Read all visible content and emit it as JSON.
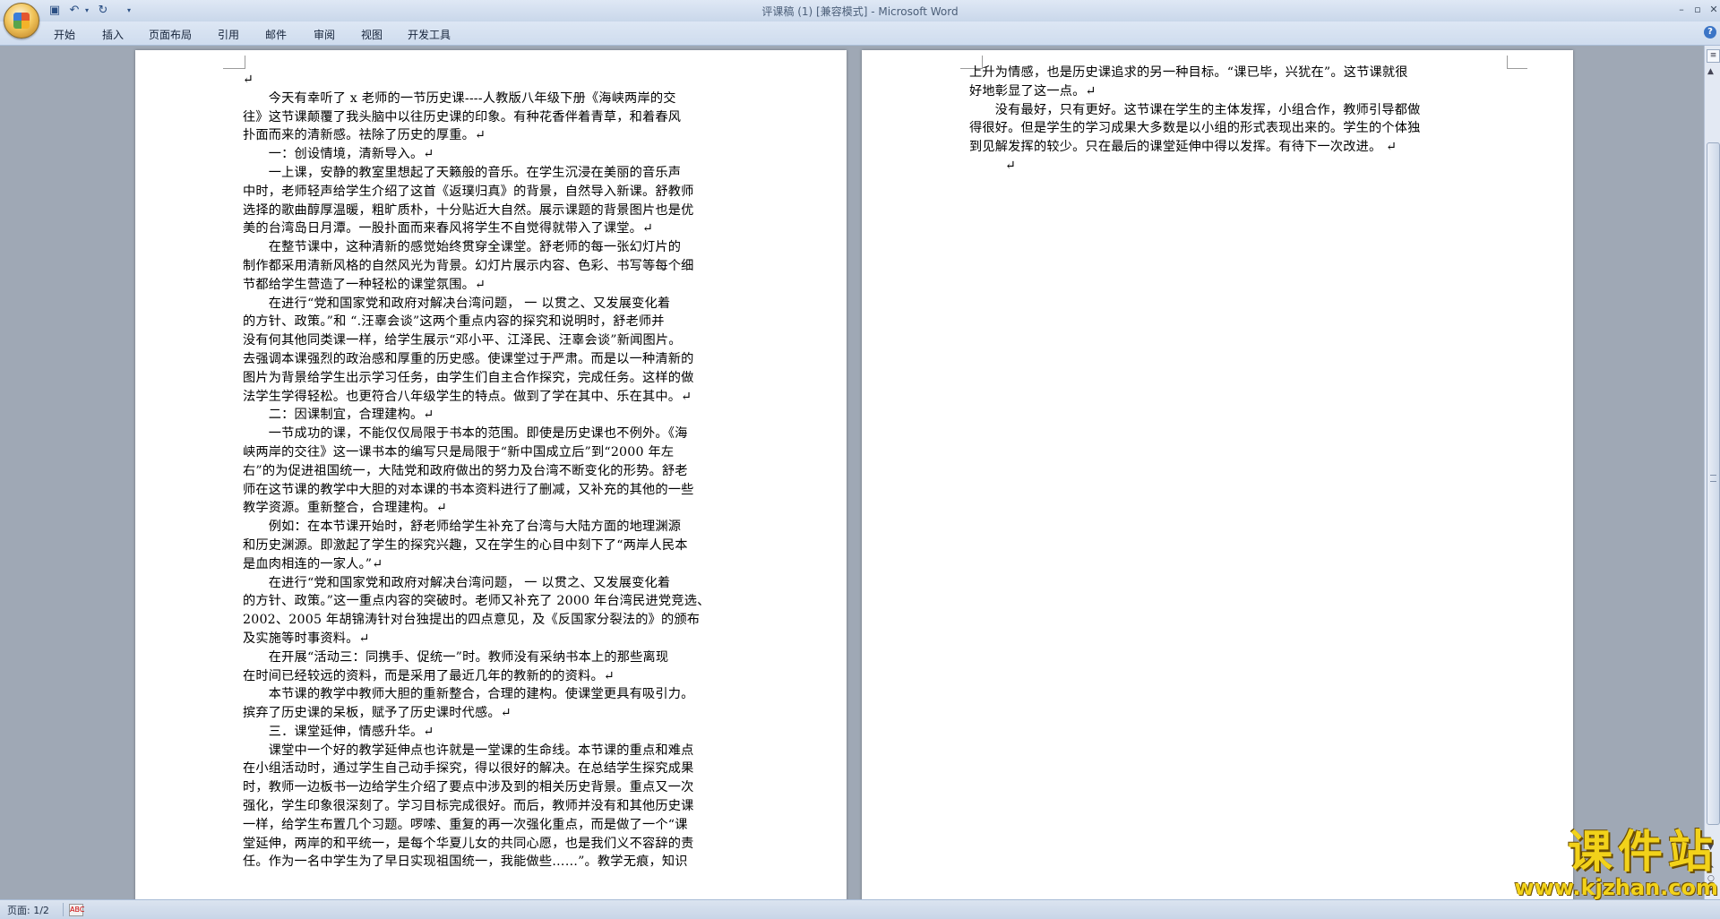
{
  "quick_access": {
    "save_icon": "▣",
    "undo_icon": "↶",
    "undo_dropdown_icon": "▾",
    "redo_icon": "↻",
    "customize_icon": "▾"
  },
  "window": {
    "title": "评课稿 (1) [兼容模式] - Microsoft Word",
    "min": "–",
    "max": "▫",
    "close": "✕"
  },
  "ribbon": {
    "tabs": [
      "开始",
      "插入",
      "页面布局",
      "引用",
      "邮件",
      "审阅",
      "视图",
      "开发工具"
    ],
    "help_icon": "?"
  },
  "document": {
    "page1_lines": [
      "↵",
      "　　今天有幸听了 x 老师的一节历史课----人教版八年级下册《海峡两岸的交",
      "往》这节课颠覆了我头脑中以往历史课的印象。有种花香伴着青草，和着春风",
      "扑面而来的清新感。祛除了历史的厚重。↵",
      "　　一：创设情境，清新导入。↵",
      "　　一上课，安静的教室里想起了天籁般的音乐。在学生沉浸在美丽的音乐声",
      "中时，老师轻声给学生介绍了这首《返璞归真》的背景，自然导入新课。舒教师",
      "选择的歌曲醇厚温暖，粗旷质朴，十分贴近大自然。展示课题的背景图片也是优",
      "美的台湾岛日月潭。一股扑面而来春风将学生不自觉得就带入了课堂。↵",
      "　　在整节课中，这种清新的感觉始终贯穿全课堂。舒老师的每一张幻灯片的",
      "制作都采用清新风格的自然风光为背景。幻灯片展示内容、色彩、书写等每个细",
      "节都给学生营造了一种轻松的课堂氛围。↵",
      "　　在进行“党和国家党和政府对解决台湾问题， 一 以贯之、又发展变化着",
      "的方针、政策。”和 “.汪辜会谈”这两个重点内容的探究和说明时，舒老师并",
      "没有何其他同类课一样，给学生展示“邓小平、江泽民、汪辜会谈”新闻图片。",
      "去强调本课强烈的政治感和厚重的历史感。使课堂过于严肃。而是以一种清新的",
      "图片为背景给学生出示学习任务，由学生们自主合作探究，完成任务。这样的做",
      "法学生学得轻松。也更符合八年级学生的特点。做到了学在其中、乐在其中。↵",
      "　　二：因课制宜，合理建构。↵",
      "　　一节成功的课，不能仅仅局限于书本的范围。即使是历史课也不例外。《海",
      "峡两岸的交往》这一课书本的编写只是局限于“新中国成立后”到“2000 年左",
      "右”的为促进祖国统一，大陆党和政府做出的努力及台湾不断变化的形势。舒老",
      "师在这节课的教学中大胆的对本课的书本资料进行了删减，又补充的其他的一些",
      "教学资源。重新整合，合理建构。↵",
      "　　例如：在本节课开始时，舒老师给学生补充了台湾与大陆方面的地理渊源",
      "和历史渊源。即激起了学生的探究兴趣，又在学生的心目中刻下了“两岸人民本",
      "是血肉相连的一家人。”↵",
      "　　在进行“党和国家党和政府对解决台湾问题， 一 以贯之、又发展变化着",
      "的方针、政策。”这一重点内容的突破时。老师又补充了 2000 年台湾民进党竞选、",
      "2002、2005 年胡锦涛针对台独提出的四点意见，及《反国家分裂法的》的颁布",
      "及实施等时事资料。↵",
      "　　在开展“活动三：同携手、促统一”时。教师没有采纳书本上的那些离现",
      "在时间已经较远的资料，而是采用了最近几年的教新的的资料。↵",
      "　　本节课的教学中教师大胆的重新整合，合理的建构。使课堂更具有吸引力。",
      "摈弃了历史课的呆板，赋予了历史课时代感。↵",
      "　　三．课堂延伸，情感升华。↵",
      "　　课堂中一个好的教学延伸点也许就是一堂课的生命线。本节课的重点和难点",
      "在小组活动时，通过学生自己动手探究，得以很好的解决。在总结学生探究成果",
      "时，教师一边板书一边给学生介绍了要点中涉及到的相关历史背景。重点又一次",
      "强化，学生印象很深刻了。学习目标完成很好。而后，教师并没有和其他历史课",
      "一样，给学生布置几个习题。啰嗦、重复的再一次强化重点，而是做了一个“课",
      "堂延伸，两岸的和平统一，是每个华夏儿女的共同心愿，也是我们义不容辞的责",
      "任。作为一名中学生为了早日实现祖国统一，我能做些……”。教学无痕，知识"
    ],
    "page2_lines": [
      "上升为情感，也是历史课追求的另一种目标。“课已毕，兴犹在”。这节课就很",
      "好地彰显了这一点。↵",
      "　　没有最好，只有更好。这节课在学生的主体发挥，小组合作，教师引导都做",
      "得很好。但是学生的学习成果大多数是以小组的形式表现出来的。学生的个体独",
      "到见解发挥的较少。只在最后的课堂延伸中得以发挥。有待下一次改进。 ↵",
      "↵"
    ]
  },
  "scrollbar": {
    "ruler_icon": "≡",
    "up_icon": "▲",
    "down_icon": "▼",
    "prev_page_icon": "⏶",
    "browse_icon": "○",
    "next_page_icon": "⏷"
  },
  "status": {
    "page": "页面: 1/2",
    "lang_icon": "ABC"
  },
  "watermark": {
    "title": "课件站",
    "url": "www.kjzhan.com"
  },
  "colors": {
    "background": "#9fa8b5",
    "ribbon": "#cfdcee",
    "watermark": "#f2d21a"
  }
}
